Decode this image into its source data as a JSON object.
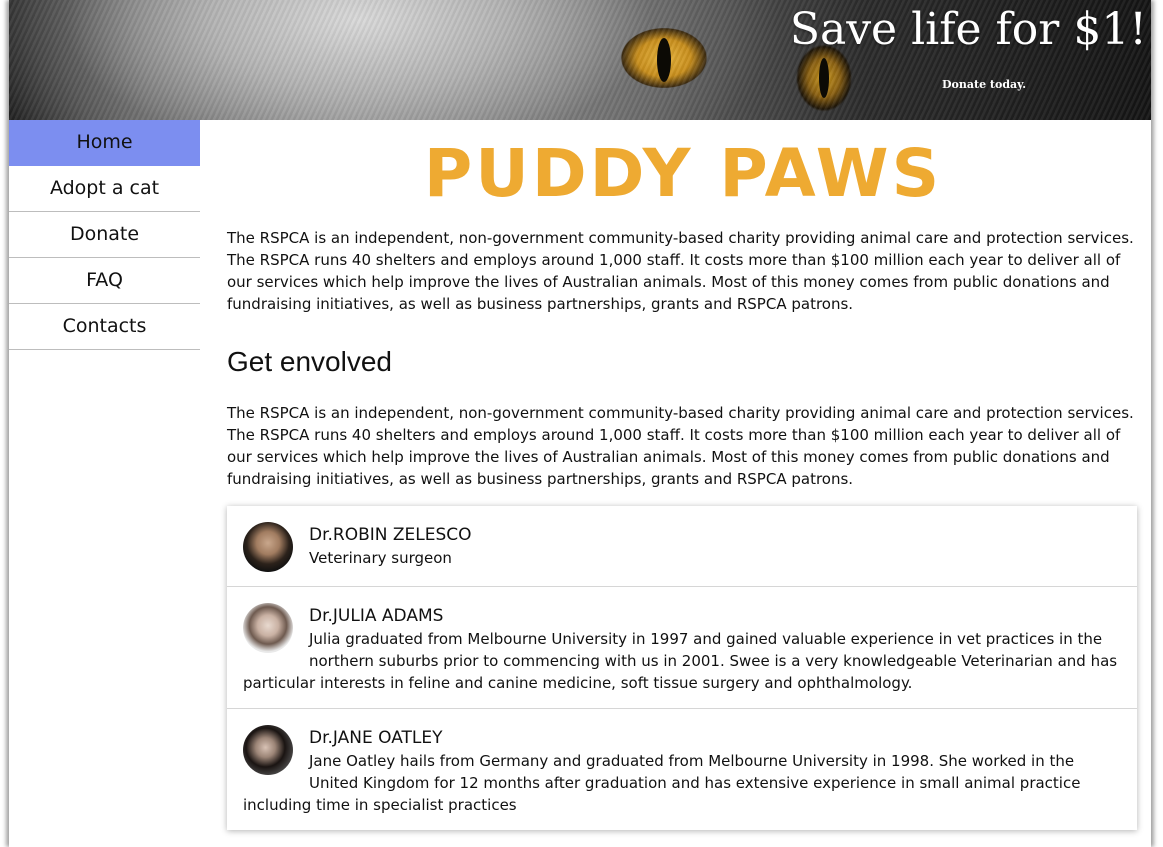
{
  "banner": {
    "title": "Save life for $1!",
    "subtitle": "Donate today."
  },
  "nav": {
    "items": [
      {
        "label": "Home",
        "active": true
      },
      {
        "label": "Adopt a cat",
        "active": false
      },
      {
        "label": "Donate",
        "active": false
      },
      {
        "label": "FAQ",
        "active": false
      },
      {
        "label": "Contacts",
        "active": false
      }
    ],
    "active_color": "#7c8ef0"
  },
  "main": {
    "logo": "PUDDY PAWS",
    "logo_color": "#eeaa32",
    "intro": "The RSPCA is an independent, non-government community-based charity providing animal care and protection services. The RSPCA runs 40 shelters and employs around 1,000 staff. It costs more than $100 million each year to deliver all of our services which help improve the lives of Australian animals. Most of this money comes from public donations and fundraising initiatives, as well as business partnerships, grants and RSPCA patrons.",
    "section_heading": "Get envolved",
    "section_text": "The RSPCA is an independent, non-government community-based charity providing animal care and protection services. The RSPCA runs 40 shelters and employs around 1,000 staff. It costs more than $100 million each year to deliver all of our services which help improve the lives of Australian animals. Most of this money comes from public donations and fundraising initiatives, as well as business partnerships, grants and RSPCA patrons."
  },
  "team": [
    {
      "name": "Dr.ROBIN ZELESCO",
      "description": "Veterinary surgeon"
    },
    {
      "name": "Dr.JULIA ADAMS",
      "description": "Julia graduated from Melbourne University in 1997 and gained valuable experience in vet practices in the northern suburbs prior to commencing with us in 2001. Swee is a very knowledgeable Veterinarian and has particular interests in feline and canine medicine, soft tissue surgery and ophthalmology."
    },
    {
      "name": "Dr.JANE OATLEY",
      "description": "Jane Oatley hails from Germany and graduated from Melbourne University in 1998. She worked in the United Kingdom for 12 months after graduation and has extensive experience in small animal practice including time in specialist practices"
    }
  ]
}
